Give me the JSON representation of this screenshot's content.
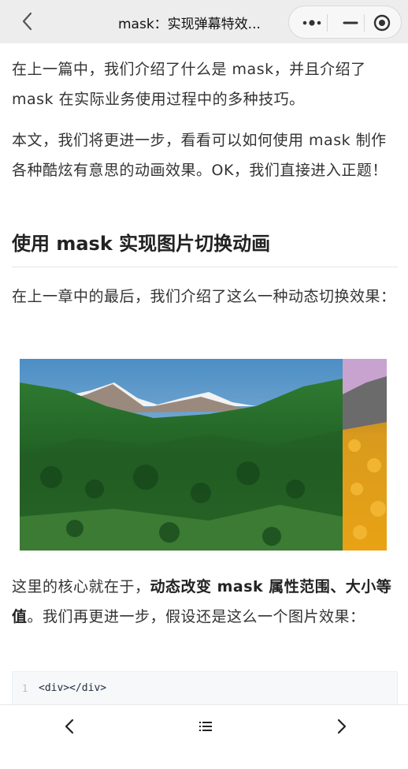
{
  "nav": {
    "title": "mask：实现弹幕特效...",
    "back_icon": "chevron-left-icon",
    "more_icon": "more-dots-icon",
    "minimize_icon": "minus-icon",
    "close_icon": "target-circle-icon"
  },
  "article": {
    "paragraph_1": "在上一篇中，我们介绍了什么是 mask，并且介绍了 mask 在实际业务使用过程中的多种技巧。",
    "paragraph_2": "本文，我们将更进一步，看看可以如何使用 mask 制作各种酷炫有意思的动画效果。OK，我们直接进入正题！",
    "heading": "使用 mask 实现图片切换动画",
    "paragraph_3": "在上一章中的最后，我们介绍了这么一种动态切换效果：",
    "paragraph_4_prefix": "这里的核心就在于，",
    "paragraph_4_bold": "动态改变 mask 属性范围、大小等值",
    "paragraph_4_suffix": "。我们再更进一步，假设还是这么一个图片效果：",
    "image_alt": "mountain-landscape-image",
    "code": {
      "line_number": "1",
      "text": "<div></div>"
    }
  },
  "bottom_bar": {
    "prev_icon": "chevron-left-icon",
    "menu_icon": "list-menu-icon",
    "next_icon": "chevron-right-icon"
  }
}
